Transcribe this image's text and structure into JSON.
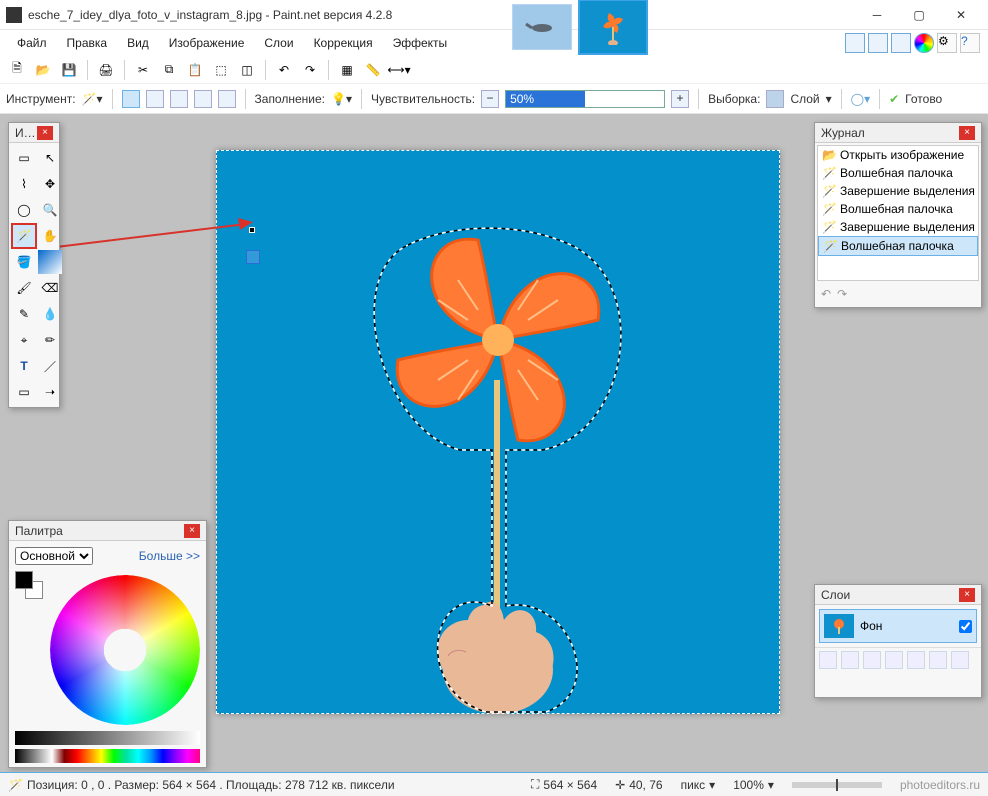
{
  "window": {
    "title": "esche_7_idey_dlya_foto_v_instagram_8.jpg - Paint.net версия 4.2.8"
  },
  "menu": {
    "items": [
      "Файл",
      "Правка",
      "Вид",
      "Изображение",
      "Слои",
      "Коррекция",
      "Эффекты"
    ]
  },
  "optbar": {
    "tool_label": "Инструмент:",
    "fill_label": "Заполнение:",
    "tolerance_label": "Чувствительность:",
    "tolerance_value": "50%",
    "sample_label": "Выборка:",
    "sample_value": "Слой",
    "commit_label": "Готово"
  },
  "tools_panel": {
    "title": "И…"
  },
  "palette": {
    "title": "Палитра",
    "primary_label": "Основной",
    "more_label": "Больше >>"
  },
  "history": {
    "title": "Журнал",
    "items": [
      "Открыть изображение",
      "Волшебная палочка",
      "Завершение выделения палочкой",
      "Волшебная палочка",
      "Завершение выделения палочкой",
      "Волшебная палочка"
    ],
    "selected_index": 5
  },
  "layers": {
    "title": "Слои",
    "layer0": {
      "name": "Фон",
      "visible": true
    }
  },
  "status": {
    "pos_size": "Позиция: 0 , 0 . Размер: 564  × 564 . Площадь: 278 712 кв. пиксели",
    "canvas_dims": "564 × 564",
    "cursor": "40, 76",
    "units": "пикс",
    "zoom": "100%",
    "watermark": "photoeditors.ru"
  }
}
